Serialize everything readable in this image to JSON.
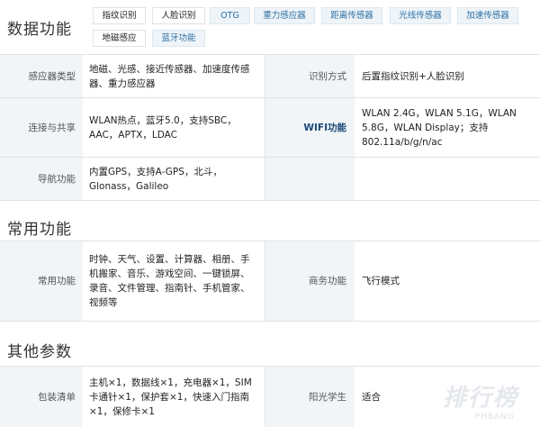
{
  "sections": {
    "data_features": "数据功能",
    "common_features": "常用功能",
    "other_params": "其他参数"
  },
  "tags": [
    {
      "label": "指纹识别",
      "style": "plain"
    },
    {
      "label": "人脸识别",
      "style": "plain"
    },
    {
      "label": "OTG",
      "style": "blue"
    },
    {
      "label": "重力感应器",
      "style": "blue"
    },
    {
      "label": "距离传感器",
      "style": "blue"
    },
    {
      "label": "光线传感器",
      "style": "blue"
    },
    {
      "label": "加速传感器",
      "style": "blue"
    },
    {
      "label": "地磁感应",
      "style": "plain"
    },
    {
      "label": "蓝牙功能",
      "style": "blue"
    }
  ],
  "data_rows": [
    {
      "k1": "感应器类型",
      "v1": "地磁、光感、接近传感器、加速度传感器、重力感应器",
      "k2": "识别方式",
      "v2": "后置指纹识别+人脸识别"
    },
    {
      "k1": "连接与共享",
      "v1": "WLAN热点，蓝牙5.0，支持SBC，AAC，APTX，LDAC",
      "k2": "WIFI功能",
      "v2": "WLAN 2.4G，WLAN 5.1G，WLAN 5.8G，WLAN Display；支持802.11a/b/g/n/ac"
    },
    {
      "k1": "导航功能",
      "v1": "内置GPS，支持A-GPS，北斗，Glonass，Galileo",
      "k2": "",
      "v2": ""
    }
  ],
  "common_rows": [
    {
      "k1": "常用功能",
      "v1": "时钟、天气、设置、计算器、相册、手机搬家、音乐、游戏空间、一键锁屏、录音、文件管理、指南针、手机管家、视频等",
      "k2": "商务功能",
      "v2": "飞行模式"
    }
  ],
  "other_rows": [
    {
      "k1": "包装清单",
      "v1": "主机×1，数据线×1，充电器×1，SIM卡通针×1，保护套×1，快速入门指南×1，保修卡×1",
      "k2": "阳光学生",
      "v2": "适合"
    }
  ],
  "watermark": {
    "main": "排行榜",
    "sub": "PHBANG"
  },
  "colors": {
    "label_bg": "#f1f5f8",
    "blue_tag_bg": "#eef4f8",
    "blue_text": "#2d6fa3",
    "border": "#e2e2e2"
  }
}
